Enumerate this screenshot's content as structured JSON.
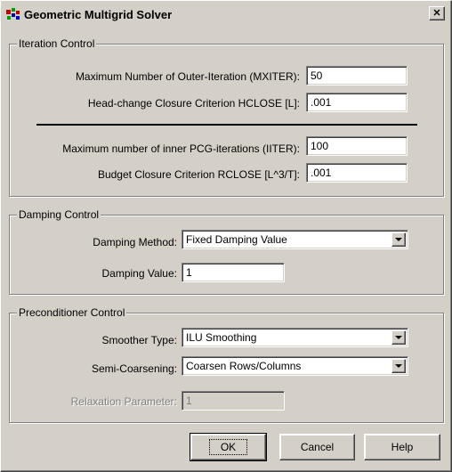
{
  "window": {
    "title": "Geometric Multigrid Solver",
    "close_glyph": "✕"
  },
  "iteration_control": {
    "legend": "Iteration Control",
    "mxiter_label": "Maximum Number of Outer-Iteration (MXITER):",
    "mxiter_value": "50",
    "hclose_label": "Head-change Closure Criterion HCLOSE [L]:",
    "hclose_value": ".001",
    "iiter_label": "Maximum number of  inner PCG-iterations (IITER):",
    "iiter_value": "100",
    "rclose_label": "Budget Closure Criterion RCLOSE [L^3/T]:",
    "rclose_value": ".001"
  },
  "damping_control": {
    "legend": "Damping Control",
    "method_label": "Damping Method:",
    "method_value": "Fixed Damping Value",
    "value_label": "Damping Value:",
    "value_value": "1"
  },
  "preconditioner_control": {
    "legend": "Preconditioner Control",
    "smoother_label": "Smoother Type:",
    "smoother_value": "ILU Smoothing",
    "coarsening_label": "Semi-Coarsening:",
    "coarsening_value": "Coarsen Rows/Columns",
    "relaxation_label": "Relaxation Parameter:",
    "relaxation_value": "1"
  },
  "buttons": {
    "ok": "OK",
    "cancel": "Cancel",
    "help": "Help"
  },
  "colors": {
    "face": "#d4d0c8",
    "shadow": "#808080",
    "highlight": "#ffffff",
    "app_icon_red": "#c00000",
    "app_icon_green": "#00a000",
    "app_icon_blue": "#0000c0"
  }
}
